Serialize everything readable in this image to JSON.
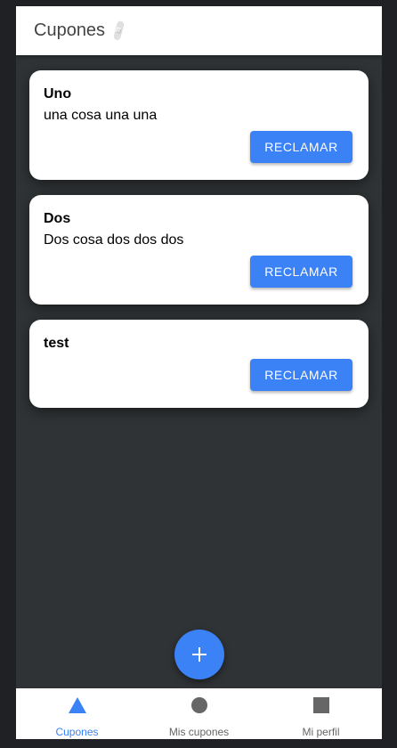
{
  "header": {
    "title": "Cupones",
    "icon": "bandage-icon"
  },
  "coupons": [
    {
      "title": "Uno",
      "description": "una cosa una una",
      "button": "RECLAMAR"
    },
    {
      "title": "Dos",
      "description": "Dos cosa dos dos dos",
      "button": "RECLAMAR"
    },
    {
      "title": "test",
      "description": "",
      "button": "RECLAMAR"
    }
  ],
  "fab": {
    "icon": "plus-icon",
    "label": "+"
  },
  "bottom_nav": [
    {
      "label": "Cupones",
      "icon": "triangle-icon",
      "active": true
    },
    {
      "label": "Mis cupones",
      "icon": "circle-icon",
      "active": false
    },
    {
      "label": "Mi perfil",
      "icon": "square-icon",
      "active": false
    }
  ],
  "colors": {
    "accent": "#3b82f6",
    "background": "#2f3335",
    "card": "#ffffff",
    "nav_inactive": "#666666"
  }
}
